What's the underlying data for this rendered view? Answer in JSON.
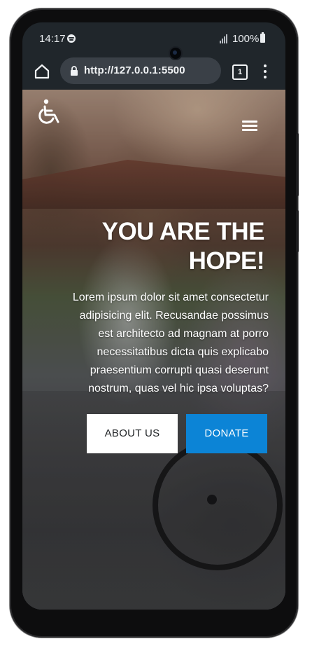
{
  "status_bar": {
    "time": "14:17",
    "battery_text": "100%"
  },
  "browser": {
    "url": "http://127.0.0.1:5500",
    "tab_count": "1"
  },
  "hero": {
    "title_line1": "YOU ARE THE",
    "title_line2": "HOPE!",
    "body_line1": "Lorem ipsum dolor sit amet consectetur",
    "body_line2": "adipisicing elit. Recusandae possimus",
    "body_line3": "est architecto ad magnam at porro",
    "body_line4": "necessitatibus dicta quis explicabo",
    "body_line5": "praesentium corrupti quasi deserunt",
    "body_line6": "nostrum, quas vel hic ipsa voluptas?"
  },
  "buttons": {
    "about_label": "ABOUT US",
    "donate_label": "DONATE"
  },
  "colors": {
    "accent": "#0c84d6",
    "browser_chrome": "#20262b"
  },
  "icons": [
    "spotify-icon",
    "signal-icon",
    "battery-icon",
    "home-icon",
    "lock-icon",
    "tabs-icon",
    "menu-icon",
    "wheelchair-icon",
    "hamburger-icon"
  ]
}
